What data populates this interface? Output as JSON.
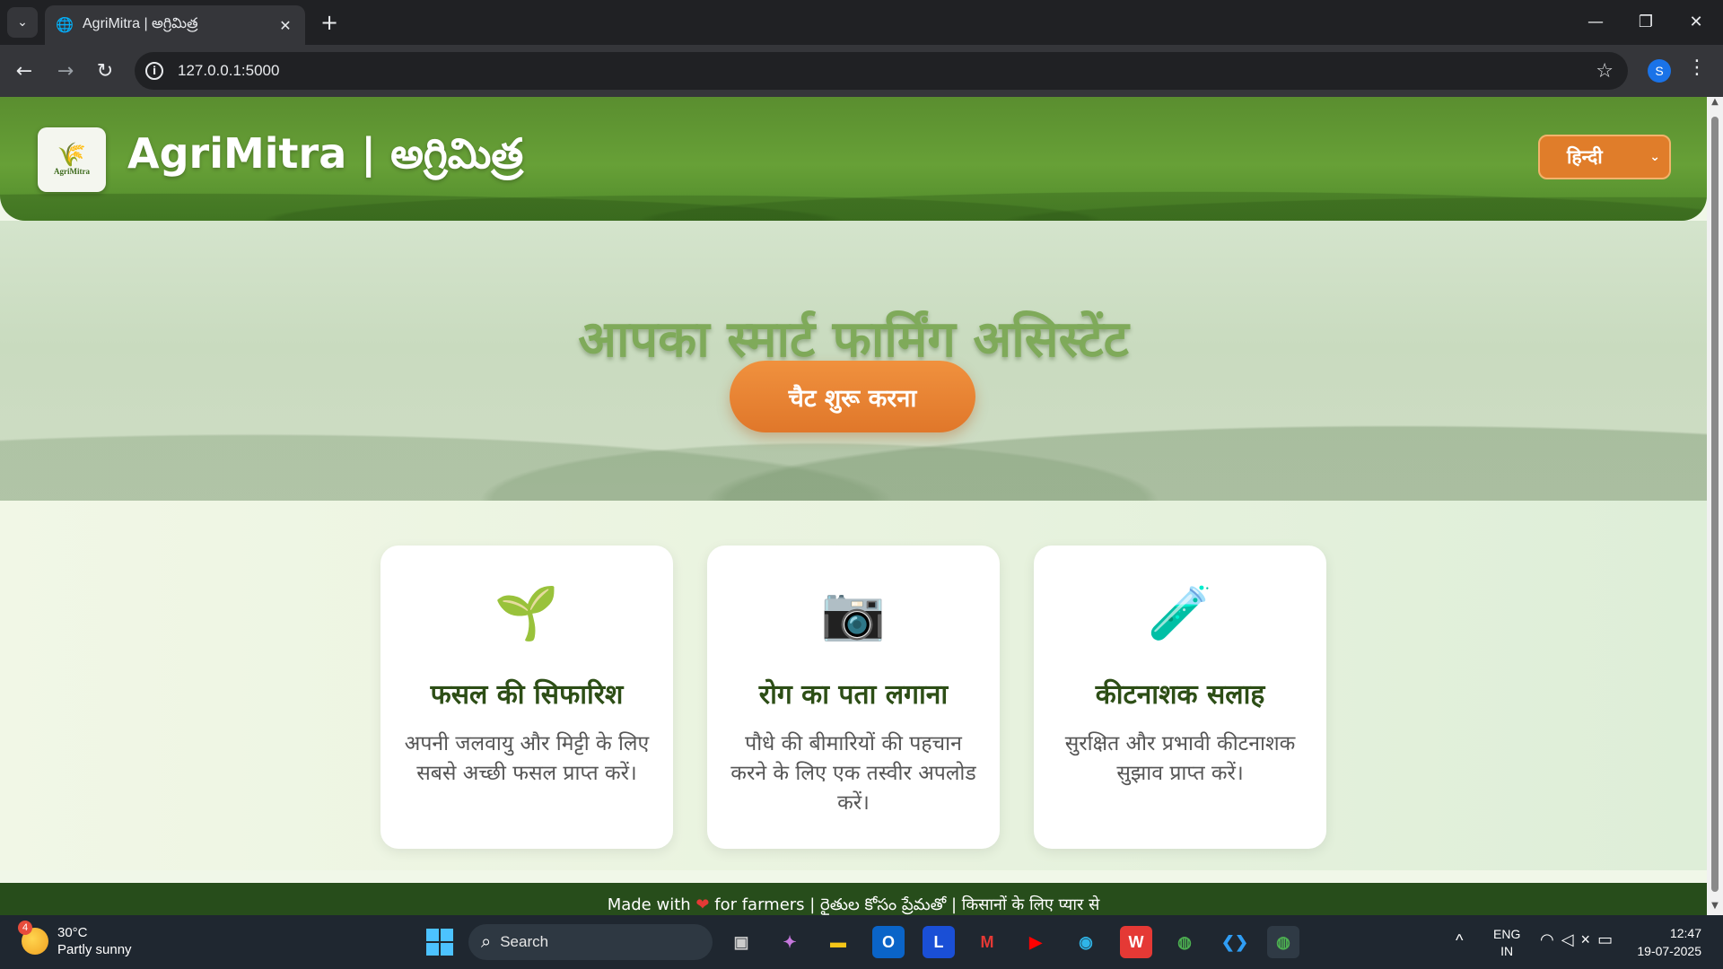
{
  "browser": {
    "tab_title": "AgriMitra | అగ్రిమిత్ర",
    "url": "127.0.0.1:5000",
    "profile_initial": "S"
  },
  "header": {
    "brand": "AgriMitra | అగ్రిమిత్ర",
    "logo_text": "AgriMitra",
    "language_selected": "हिन्दी"
  },
  "hero": {
    "title": "आपका स्मार्ट फार्मिंग असिस्टेंट",
    "cta_label": "चैट शुरू करना"
  },
  "features": [
    {
      "icon": "seedling-icon",
      "glyph": "🌱",
      "title": "फसल की सिफारिश",
      "description": "अपनी जलवायु और मिट्टी के लिए सबसे अच्छी फसल प्राप्त करें।"
    },
    {
      "icon": "camera-icon",
      "glyph": "📷",
      "title": "रोग का पता लगाना",
      "description": "पौधे की बीमारियों की पहचान करने के लिए एक तस्वीर अपलोड करें।"
    },
    {
      "icon": "test-tube-icon",
      "glyph": "🧪",
      "title": "कीटनाशक सलाह",
      "description": "सुरक्षित और प्रभावी कीटनाशक सुझाव प्राप्त करें।"
    }
  ],
  "footer": {
    "before_heart": "Made with",
    "after_heart": "for farmers | రైతుల కోసం ప్రేమతో | किसानों के लिए प्यार से"
  },
  "taskbar": {
    "weather_temp": "30°C",
    "weather_desc": "Partly sunny",
    "weather_badge": "4",
    "search_label": "Search",
    "lang_line1": "ENG",
    "lang_line2": "IN",
    "time": "12:47",
    "date": "19-07-2025"
  },
  "colors": {
    "header_green": "#67a037",
    "accent_orange": "#e07d2a",
    "title_dark_green": "#2d4e16",
    "footer_green": "#274d1b"
  }
}
